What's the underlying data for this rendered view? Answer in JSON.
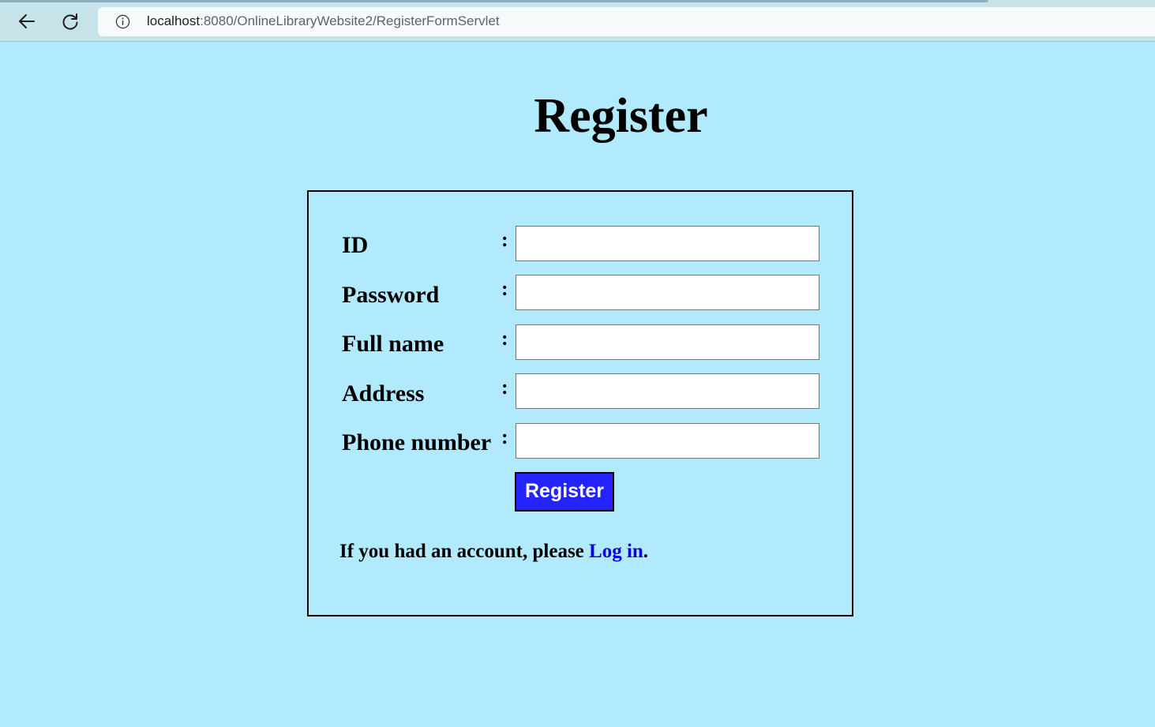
{
  "browser": {
    "url_host": "localhost",
    "url_rest": ":8080/OnlineLibraryWebsite2/RegisterFormServlet"
  },
  "page": {
    "title": "Register",
    "background": "#b0eafc"
  },
  "form": {
    "fields": [
      {
        "label": "ID",
        "colon": ":",
        "value": "",
        "type": "text"
      },
      {
        "label": "Password",
        "colon": ":",
        "value": "",
        "type": "password"
      },
      {
        "label": "Full name",
        "colon": ":",
        "value": "",
        "type": "text"
      },
      {
        "label": "Address",
        "colon": ":",
        "value": "",
        "type": "text"
      },
      {
        "label": "Phone number",
        "colon": ":",
        "value": "",
        "type": "text"
      }
    ],
    "submit_label": "Register",
    "submit_color": "#2323ff",
    "account_prefix": "If you had an account, please ",
    "login_link": "Log in",
    "account_suffix": ".",
    "link_color": "#0000ee"
  }
}
